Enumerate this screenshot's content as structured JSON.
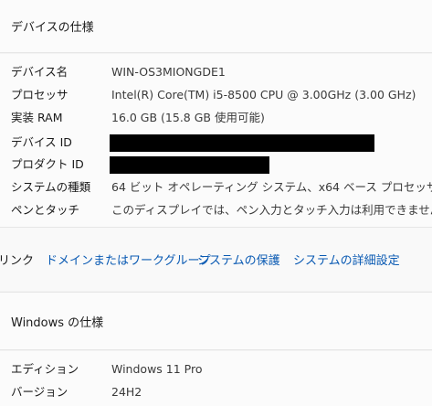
{
  "device_spec": {
    "title": "デバイスの仕様",
    "rows": [
      {
        "label": "デバイス名",
        "value": "WIN-OS3MIONGDE1"
      },
      {
        "label": "プロセッサ",
        "value": "Intel(R) Core(TM) i5-8500 CPU @ 3.00GHz   (3.00 GHz)"
      },
      {
        "label": "実装 RAM",
        "value": "16.0 GB (15.8 GB 使用可能)"
      },
      {
        "label": "デバイス ID",
        "value": ""
      },
      {
        "label": "プロダクト ID",
        "value": ""
      },
      {
        "label": "システムの種類",
        "value": "64 ビット オペレーティング システム、x64 ベース プロセッサ"
      },
      {
        "label": "ペンとタッチ",
        "value": "このディスプレイでは、ペン入力とタッチ入力は利用できません"
      }
    ]
  },
  "related_links": {
    "label": "リンク",
    "links": [
      "ドメインまたはワークグループ",
      "システムの保護",
      "システムの詳細設定"
    ]
  },
  "windows_spec": {
    "title": "Windows の仕様",
    "rows": [
      {
        "label": "エディション",
        "value": "Windows 11 Pro"
      },
      {
        "label": "バージョン",
        "value": "24H2"
      }
    ]
  }
}
